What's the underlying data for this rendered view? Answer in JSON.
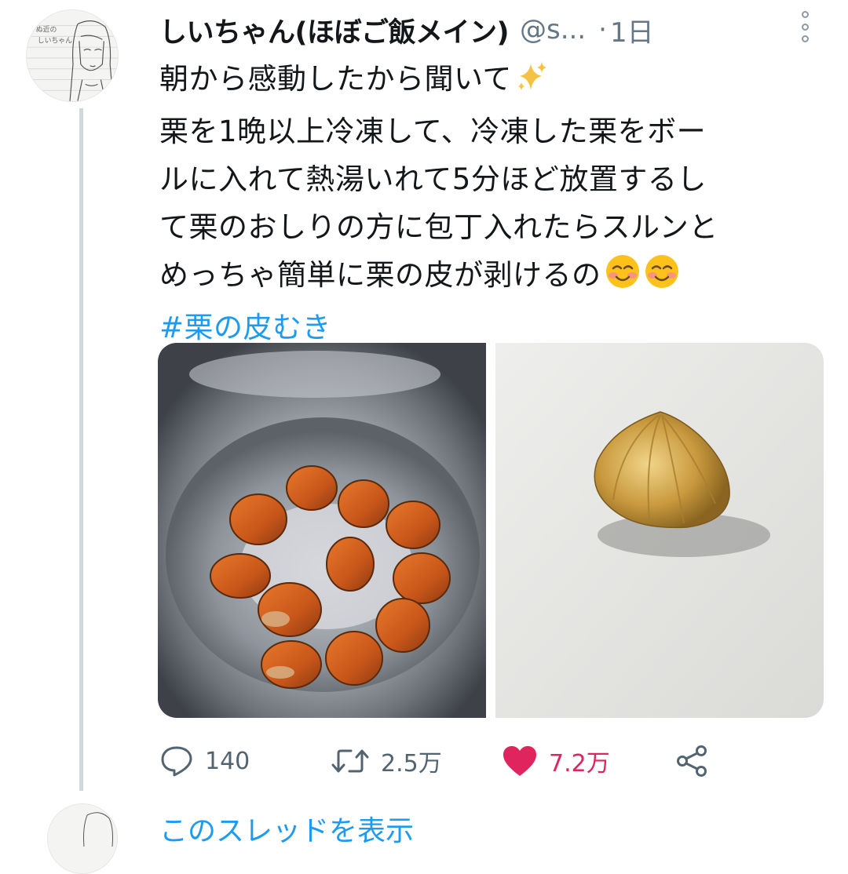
{
  "tweet": {
    "display_name": "しいちゃん(ほぼご飯メイン)",
    "handle": "@s...",
    "separator": "·",
    "time": "1日",
    "text_lines": [
      "朝から感動したから聞いて",
      "栗を1晩以上冷凍して、冷凍した栗をボー",
      "ルに入れて熱湯いれて5分ほど放置するし",
      "て栗のおしりの方に包丁入れたらスルンと",
      "めっちゃ簡単に栗の皮が剥けるの"
    ],
    "hashtag": "#栗の皮むき",
    "avatar_text": [
      "ぬ近の",
      "しいちゃん"
    ]
  },
  "actions": {
    "reply_count": "140",
    "retweet_count": "2.5万",
    "like_count": "7.2万"
  },
  "footer": {
    "show_thread_label": "このスレッドを表示"
  },
  "colors": {
    "link": "#1d9bf0",
    "like": "#e0245e",
    "muted": "#536471",
    "thread_line": "#cfd9de"
  },
  "icons": [
    "reply-icon",
    "retweet-icon",
    "heart-icon",
    "share-icon",
    "more-icon",
    "sparkles-icon",
    "smiling-face-icon"
  ]
}
